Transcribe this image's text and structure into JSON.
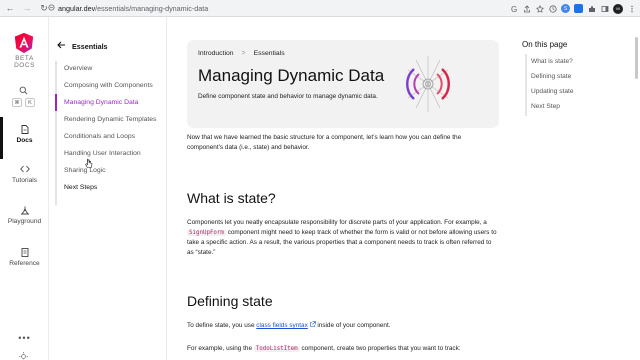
{
  "browser": {
    "back": "←",
    "forward": "→",
    "reload": "↻",
    "url_host": "angular.dev",
    "url_path": "/essentials/managing-dynamic-data",
    "avatar": "M"
  },
  "rail": {
    "beta": "BETA",
    "docs_word": "DOCS",
    "kbd": [
      "⌘",
      "K"
    ],
    "items": [
      {
        "label": "Docs",
        "icon": "document-icon"
      },
      {
        "label": "Tutorials",
        "icon": "code-icon"
      },
      {
        "label": "Playground",
        "icon": "playground-icon"
      },
      {
        "label": "Reference",
        "icon": "reference-icon"
      }
    ],
    "more": "•••"
  },
  "secnav": {
    "heading": "Essentials",
    "items": [
      {
        "label": "Overview"
      },
      {
        "label": "Composing with Components"
      },
      {
        "label": "Managing Dynamic Data"
      },
      {
        "label": "Rendering Dynamic Templates"
      },
      {
        "label": "Conditionals and Loops"
      },
      {
        "label": "Handling User Interaction"
      },
      {
        "label": "Sharing Logic"
      },
      {
        "label": "Next Steps"
      }
    ]
  },
  "hero": {
    "crumb1": "Introduction",
    "crumb_sep": ">",
    "crumb2": "Essentials",
    "title": "Managing Dynamic Data",
    "description": "Define component state and behavior to manage dynamic data."
  },
  "content": {
    "intro": "Now that we have learned the basic structure for a component, let’s learn how you can define the component’s data (i.e., state) and behavior.",
    "h_state": "What is state?",
    "state_p_1": "Components let you neatly encapsulate responsibility for discrete parts of your application. For example, a ",
    "state_code": "SignUpForm",
    "state_p_2": " component might need to keep track of whether the form is valid or not before allowing users to take a specific action. As a result, the various properties that a component needs to track is often referred to as “state.”",
    "h_defining": "Defining state",
    "define_p_1": "To define state, you use ",
    "define_link": "class fields syntax",
    "define_p_2": " inside of your component.",
    "example_p_1": "For example, using the ",
    "example_code": "TodoListItem",
    "example_p_2": " component, create two properties that you want to track:"
  },
  "on_this_page": {
    "title": "On this page",
    "items": [
      "What is state?",
      "Defining state",
      "Updating state",
      "Next Step"
    ]
  },
  "colors": {
    "accent": "#9b29c8",
    "hero_bg": "#f3f2f2",
    "link": "#1d4fd0",
    "code_text": "#b0306a"
  }
}
